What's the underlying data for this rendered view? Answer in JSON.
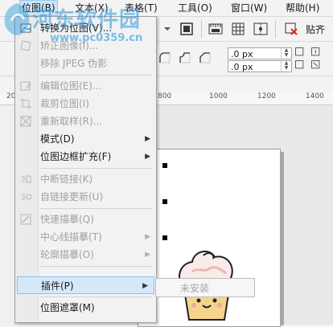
{
  "menubar": {
    "items": [
      {
        "label": "位图(B)"
      },
      {
        "label": "文本(X)"
      },
      {
        "label": "表格(T)"
      },
      {
        "label": "工具(O)"
      },
      {
        "label": "窗口(W)"
      },
      {
        "label": "帮助(H)"
      }
    ]
  },
  "toolbar": {
    "paste_label": "贴齐"
  },
  "propertybar": {
    "offset_x": ".0 px",
    "offset_y": ".0 px"
  },
  "ruler": {
    "ticks": [
      "20",
      "800",
      "1000",
      "1200",
      "1400"
    ]
  },
  "watermark": {
    "title": "河东软件园",
    "url": "www.pc0359.cn"
  },
  "bitmap_menu": {
    "items": [
      {
        "label": "转换为位图(V)..."
      },
      {
        "label": "矫正图像(I)..."
      },
      {
        "label": "移除 JPEG 伪影"
      },
      {
        "label": "编辑位图(E)..."
      },
      {
        "label": "裁剪位图(I)"
      },
      {
        "label": "重新取样(R)..."
      },
      {
        "label": "模式(D)"
      },
      {
        "label": "位图边框扩充(F)"
      },
      {
        "label": "中断链接(K)"
      },
      {
        "label": "自链接更新(U)"
      },
      {
        "label": "快速描摹(Q)"
      },
      {
        "label": "中心线描摹(T)"
      },
      {
        "label": "轮廓描摹(O)"
      },
      {
        "label": "插件(P)"
      },
      {
        "label": "位图遮罩(M)"
      }
    ]
  },
  "plugin_submenu": {
    "item": "未安装"
  }
}
